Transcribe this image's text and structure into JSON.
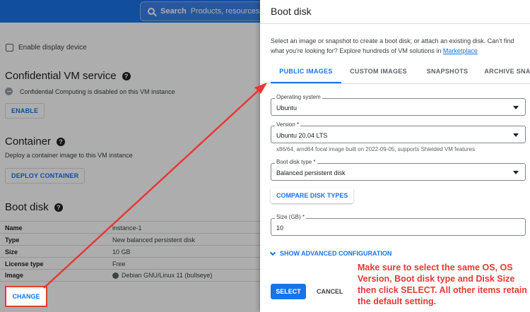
{
  "search": {
    "bold": "Search",
    "placeholder": "Products, resources"
  },
  "left": {
    "display_device_label": "Enable display device",
    "confidential": {
      "title": "Confidential VM service",
      "status": "Confidential Computing is disabled on this VM instance",
      "button": "ENABLE"
    },
    "container": {
      "title": "Container",
      "desc": "Deploy a container image to this VM instance",
      "button": "DEPLOY CONTAINER"
    },
    "boot_disk": {
      "title": "Boot disk",
      "rows": [
        {
          "k": "Name",
          "v": "instance-1"
        },
        {
          "k": "Type",
          "v": "New balanced persistent disk"
        },
        {
          "k": "Size",
          "v": "10 GB"
        },
        {
          "k": "License type",
          "v": "Free"
        },
        {
          "k": "Image",
          "v": "Debian GNU/Linux 11 (bullseye)"
        }
      ],
      "change_button": "CHANGE"
    }
  },
  "panel": {
    "title": "Boot disk",
    "intro": "Select an image or snapshot to create a boot disk; or attach an existing disk. Can't find what you're looking for? Explore hundreds of VM solutions in",
    "intro_link": "Marketplace",
    "tabs": [
      "PUBLIC IMAGES",
      "CUSTOM IMAGES",
      "SNAPSHOTS",
      "ARCHIVE SNA"
    ],
    "os": {
      "label": "Operating system",
      "value": "Ubuntu"
    },
    "version": {
      "label": "Version *",
      "value": "Ubuntu 20.04 LTS",
      "helper": "x86/64, amd64 focal image built on 2022-09-05, supports Shielded VM features"
    },
    "disk_type": {
      "label": "Boot disk type *",
      "value": "Balanced persistent disk"
    },
    "compare_button": "COMPARE DISK TYPES",
    "size": {
      "label": "Size (GB) *",
      "value": "10"
    },
    "advanced": "SHOW ADVANCED CONFIGURATION",
    "select_button": "SELECT",
    "cancel_button": "CANCEL"
  },
  "annotation": {
    "note": "Make sure to select the same OS, OS Version, Boot disk type and Disk Size then click SELECT. All other items retain the default setting.",
    "color": "#e53935"
  }
}
